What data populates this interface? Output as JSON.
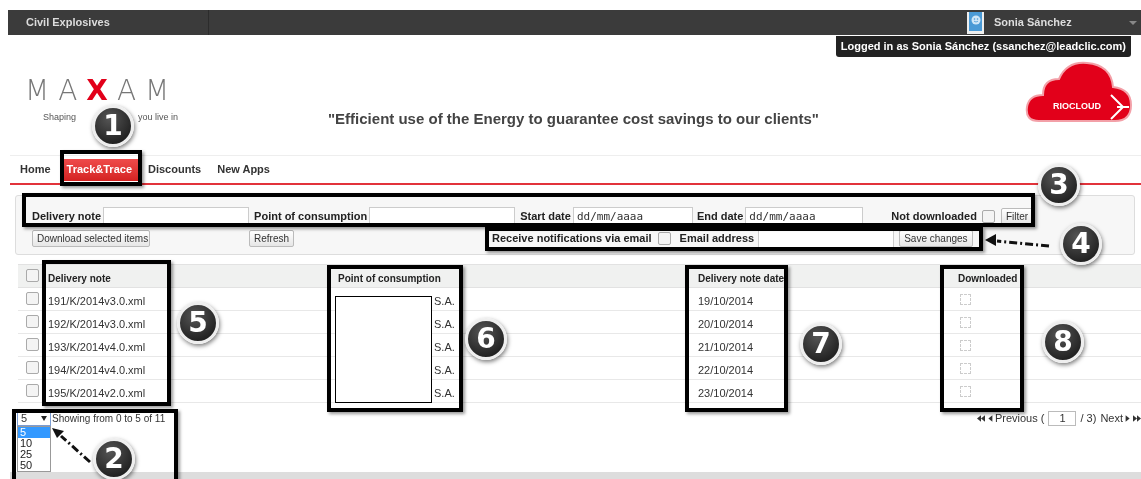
{
  "top_bar": {
    "app_name": "Civil Explosives",
    "user_name": "Sonia Sánchez",
    "tooltip": "Logged in as Sonia Sánchez (ssanchez@leadclic.com)"
  },
  "header": {
    "logo_text": "MAXAM",
    "tagline_start": "Shaping",
    "tagline_end": "you live in",
    "slogan": "\"Efficient use of the Energy to guarantee cost savings to our clients\"",
    "cloud_label": "RIOCLOUD"
  },
  "nav": [
    {
      "label": "Home",
      "selected": false
    },
    {
      "label": "Track&Trace",
      "selected": true
    },
    {
      "label": "Discounts",
      "selected": false
    },
    {
      "label": "New Apps",
      "selected": false
    }
  ],
  "filters": {
    "delivery_note_label": "Delivery note",
    "consumption_label": "Point of consumption",
    "start_date_label": "Start date",
    "start_date_placeholder": "dd/mm/aaaa",
    "end_date_label": "End date",
    "end_date_placeholder": "dd/mm/aaaa",
    "not_downloaded_label": "Not downloaded",
    "not_downloaded_checked": false,
    "filter_button": "Filter"
  },
  "actions": {
    "download_button": "Download selected items",
    "refresh_button": "Refresh",
    "notifications_label": "Receive notifications via email",
    "notifications_checked": false,
    "email_label": "Email address",
    "save_button": "Save changes"
  },
  "table": {
    "columns": [
      "Delivery note",
      "Point of consumption",
      "Delivery note date",
      "Downloaded"
    ],
    "all_checked": false,
    "rows": [
      {
        "checked": false,
        "delivery_note": "191/K/2014v3.0.xml",
        "consumption": "S.A.",
        "date": "19/10/2014",
        "downloaded": false
      },
      {
        "checked": false,
        "delivery_note": "192/K/2014v3.0.xml",
        "consumption": "S.A.",
        "date": "20/10/2014",
        "downloaded": false
      },
      {
        "checked": false,
        "delivery_note": "193/K/2014v4.0.xml",
        "consumption": "S.A.",
        "date": "21/10/2014",
        "downloaded": false
      },
      {
        "checked": false,
        "delivery_note": "194/K/2014v4.0.xml",
        "consumption": "S.A.",
        "date": "22/10/2014",
        "downloaded": false
      },
      {
        "checked": false,
        "delivery_note": "195/K/2014v2.0.xml",
        "consumption": "S.A.",
        "date": "23/10/2014",
        "downloaded": false
      }
    ]
  },
  "page_size": {
    "value": "5",
    "expanded": true,
    "options": [
      {
        "label": "5",
        "selected": true
      },
      {
        "label": "10",
        "selected": false
      },
      {
        "label": "25",
        "selected": false
      },
      {
        "label": "50",
        "selected": false
      }
    ]
  },
  "showing": "Showing from 0 to 5 of 11",
  "pagination": {
    "previous": "Previous (",
    "page": "1",
    "total": "/ 3)",
    "next": "Next"
  },
  "callouts": [
    {
      "number": "1",
      "arrow": false
    },
    {
      "number": "2",
      "arrow": true
    },
    {
      "number": "3",
      "arrow": false
    },
    {
      "number": "4",
      "arrow": true
    },
    {
      "number": "5",
      "arrow": false
    },
    {
      "number": "6",
      "arrow": false
    },
    {
      "number": "7",
      "arrow": false
    },
    {
      "number": "8",
      "arrow": false
    }
  ]
}
